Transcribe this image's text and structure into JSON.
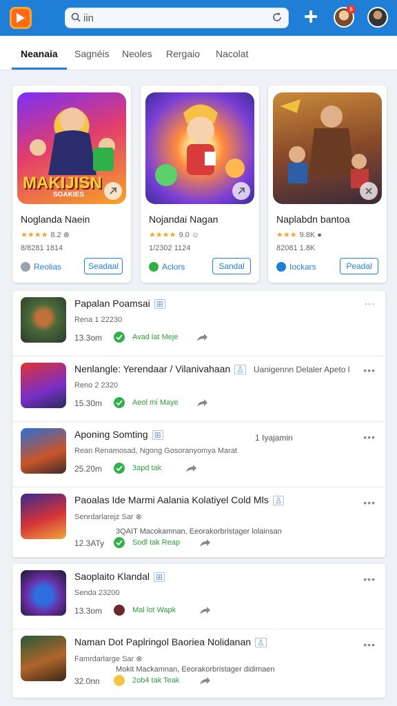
{
  "search": {
    "value": "iin"
  },
  "topbar": {
    "badge": "8"
  },
  "tabs": [
    {
      "label": "Neanaia"
    },
    {
      "label": "Sagnéis"
    },
    {
      "label": "Neoles"
    },
    {
      "label": "Rergaio"
    },
    {
      "label": "Nacolat"
    }
  ],
  "featured": [
    {
      "art_text": "MAKIJISN",
      "art_sub": "SOAKIES",
      "title": "Noglanda Naein",
      "stars": "★★★★",
      "rating": "8.2 ⊗",
      "meta": "8/8281  1814",
      "category": "Reolias",
      "cat_color": "#9aa3ad",
      "button": "Seadaal"
    },
    {
      "art_text": "",
      "art_sub": "",
      "title": "Nojandai Nagan",
      "stars": "★★★★",
      "rating": "9.0 ☺",
      "meta": "1/2302  1124",
      "category": "Aclors",
      "cat_color": "#2fb04a",
      "button": "Sandal"
    },
    {
      "art_text": "",
      "art_sub": "",
      "title": "Naplabdn bantoa",
      "stars": "★★★",
      "rating": "9.8K ●",
      "meta": "82081  1.8K",
      "category": "Iockars",
      "cat_color": "#1f7fd6",
      "button": "Peadal"
    }
  ],
  "rows": [
    {
      "title": "Papalan Poamsai",
      "tag": "⊞",
      "sub": "Rena 1 22230",
      "note": "",
      "note2": "",
      "time": "13.3om",
      "status": "Avad lat Meje",
      "status_color": "#2fb04a",
      "more": "⋮"
    },
    {
      "title": "Nenlangle: Yerendaar / Vilanivahaan",
      "tag": "♙",
      "sub": "Reno 2 2320",
      "note": "Uanigennn Delaler Apeto l",
      "note2": "",
      "time": "15.30m",
      "status": "Aeol mi Maye",
      "status_color": "#2fb04a",
      "more": "•••"
    },
    {
      "title": "Aponing Somting",
      "tag": "⊞",
      "sub": "Rean Renamosad, Ngong Gosoranyomya Marat",
      "note": "1 Iyajamin",
      "note2": "",
      "time": "25.20m",
      "status": "3apd tak",
      "status_color": "#2fb04a",
      "more": "•••"
    },
    {
      "title": "Paoalas Ide Marmi Aalania Kolatiyel Cold Mls",
      "tag": "♙",
      "sub": "Senrdarlarejz  Sar ⊗",
      "note": "",
      "note2": "3QAIT   Macokamnan, Eeorakorbristager lolainsan",
      "time": "12.3ATy",
      "status": "Sodl tak  Reap",
      "status_color": "#2fb04a",
      "more": "•••"
    },
    {
      "title": "Saoplaito Klandal",
      "tag": "⊞",
      "sub": "Senda 23200",
      "note": "",
      "note2": "",
      "time": "13.3om",
      "status": "Mal lot  Wapk",
      "status_color": "#2fb04a",
      "more": "•••"
    },
    {
      "title": "Naman Dot Paplringol Baoriea Nolidanan",
      "tag": "♙",
      "sub": "Famrdarlarge  Sar ⊗",
      "note": "",
      "note2": "Mokit    Mackamnan, Eeorakorbristager didimaen",
      "time": "32.0nn",
      "status": "2ob4 tak  Teak",
      "status_color": "#2fb04a",
      "more": "•••"
    }
  ]
}
